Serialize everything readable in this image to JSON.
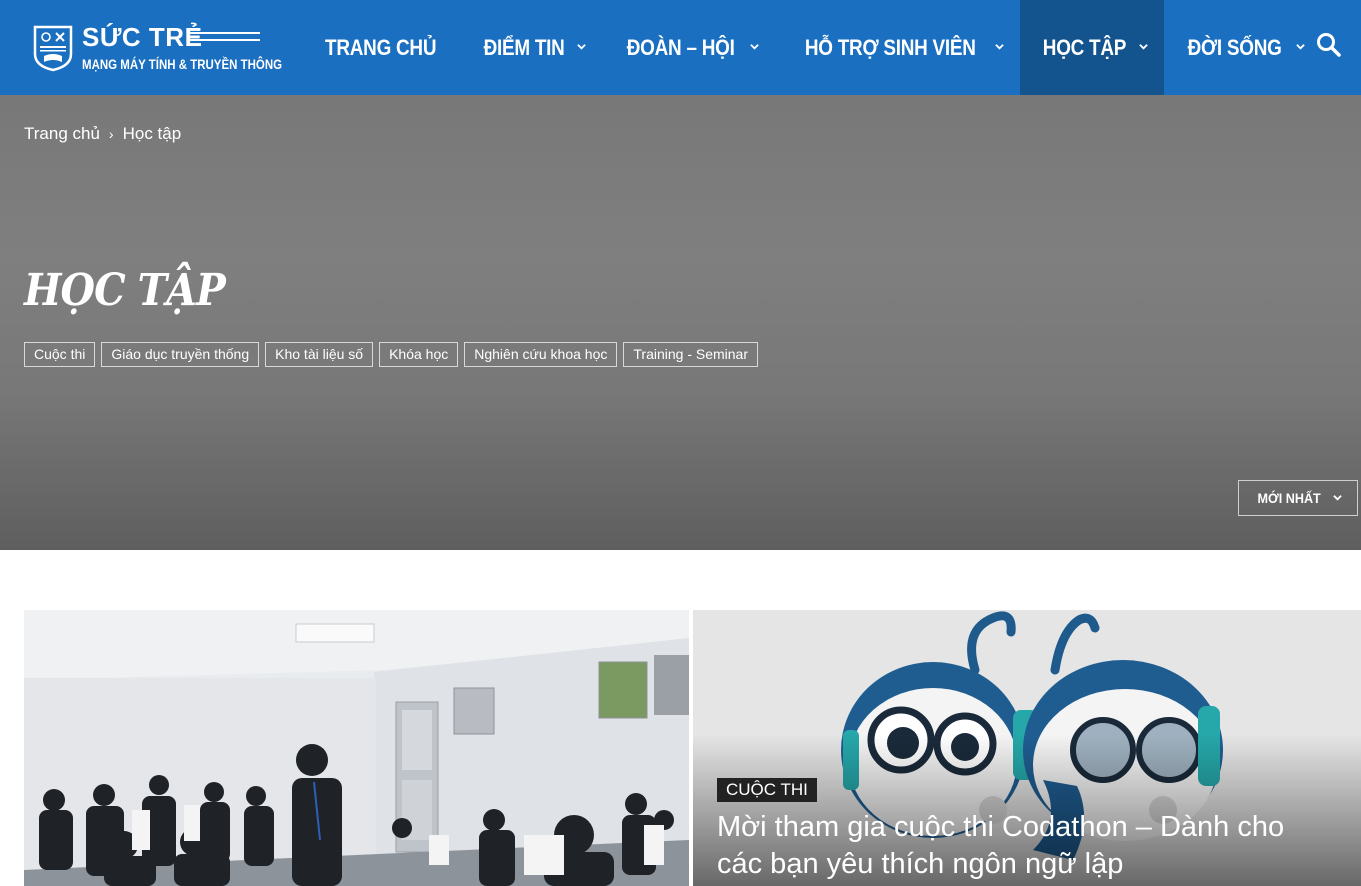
{
  "logo": {
    "title": "SỨC TRẺ",
    "subtitle": "MẠNG MÁY TÍNH & TRUYỀN THÔNG"
  },
  "nav": {
    "items": [
      {
        "label": "TRANG CHỦ",
        "has_dropdown": false
      },
      {
        "label": "ĐIỂM TIN",
        "has_dropdown": true
      },
      {
        "label": "ĐOÀN – HỘI",
        "has_dropdown": true
      },
      {
        "label": "HỖ TRỢ SINH VIÊN",
        "has_dropdown": true
      },
      {
        "label": "HỌC TẬP",
        "has_dropdown": true,
        "active": true
      },
      {
        "label": "ĐỜI SỐNG",
        "has_dropdown": true
      }
    ],
    "search_icon": "search-icon"
  },
  "breadcrumb": {
    "home": "Trang chủ",
    "separator": "›",
    "current": "Học tập"
  },
  "page": {
    "title": "HỌC TẬP"
  },
  "tags": [
    "Cuộc thi",
    "Giáo dục truyền thống",
    "Kho tài liệu số",
    "Khóa học",
    "Nghiên cứu khoa học",
    "Training - Seminar"
  ],
  "sort": {
    "label": "MỚI NHẤT"
  },
  "articles": [
    {
      "category": "",
      "title": ""
    },
    {
      "category": "CUỘC THI",
      "title": "Mời tham gia cuộc thi Codathon – Dành cho các bạn yêu thích ngôn ngữ lập"
    }
  ],
  "colors": {
    "header_bg": "#1a6fc0",
    "nav_active_bg": "#13548f",
    "hero_bg": "#7a7a7a",
    "badge_bg": "#222222"
  }
}
